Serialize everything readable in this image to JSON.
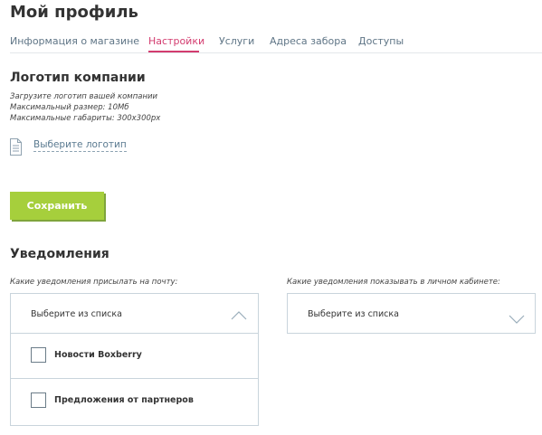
{
  "page": {
    "title": "Мой профиль"
  },
  "tabs": [
    {
      "label": "Информация о магазине",
      "active": false
    },
    {
      "label": "Настройки",
      "active": true
    },
    {
      "label": "Услуги",
      "active": false
    },
    {
      "label": "Адреса забора",
      "active": false
    },
    {
      "label": "Доступы",
      "active": false
    }
  ],
  "logo": {
    "title": "Логотип компании",
    "hint_upload": "Загрузите логотип вашей компании",
    "hint_size": "Максимальный размер: 10Мб",
    "hint_dimensions": "Максимальные габариты: 300x300px",
    "choose_label": "Выберите логотип",
    "icon": "document-icon"
  },
  "save_button": {
    "label": "Сохранить"
  },
  "notifications": {
    "title": "Уведомления",
    "email": {
      "label": "Какие уведомления присылать на почту:",
      "placeholder": "Выберите из списка",
      "state": "open",
      "options": [
        {
          "label": "Новости Boxberry",
          "checked": false
        },
        {
          "label": "Предложения от партнеров",
          "checked": false
        }
      ]
    },
    "cabinet": {
      "label": "Какие уведомления показывать в личном кабинете:",
      "placeholder": "Выберите из списка",
      "state": "closed"
    }
  },
  "colors": {
    "accent_tab": "#d33c6f",
    "tab_text": "#5f7586",
    "save_button_bg": "#a6cf3c",
    "border": "#c9d4dc"
  }
}
